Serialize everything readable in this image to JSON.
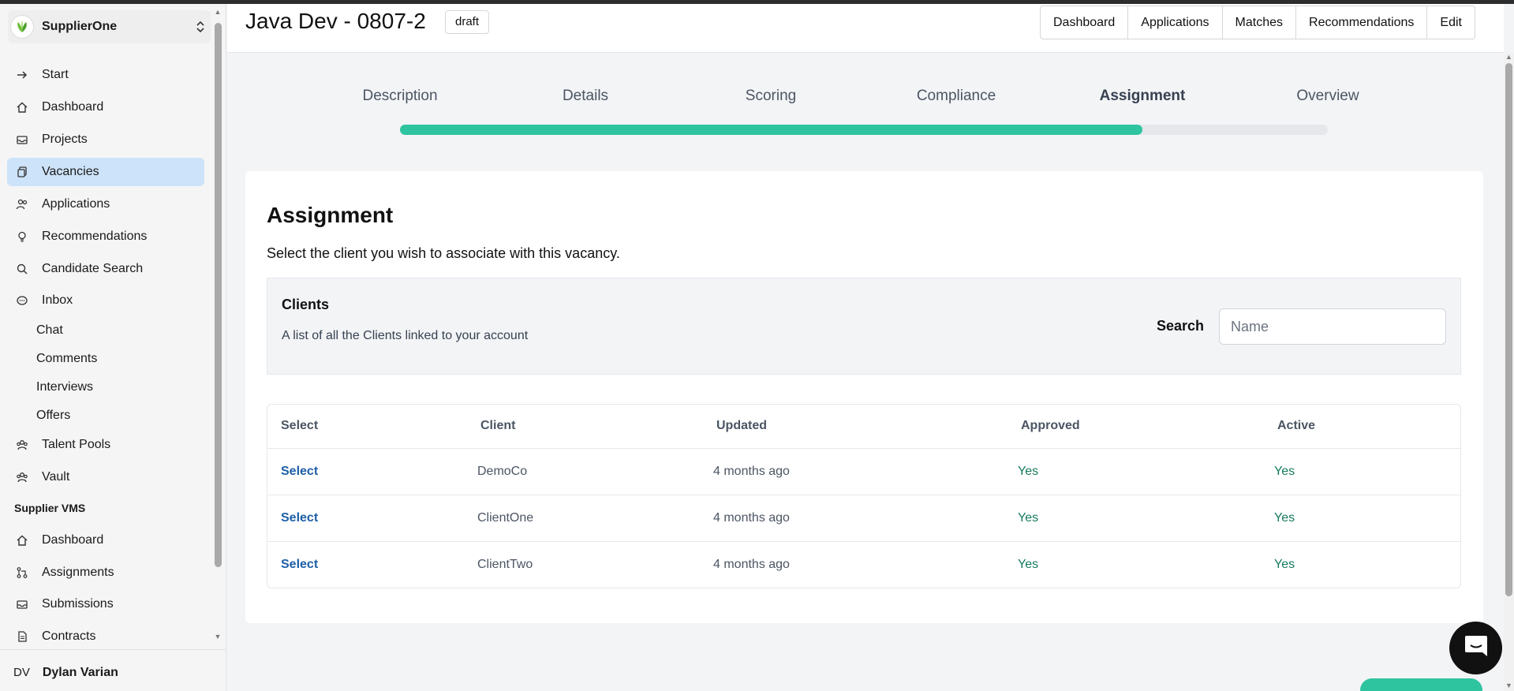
{
  "org": {
    "name": "SupplierOne"
  },
  "sidebar": {
    "items": [
      {
        "label": "Start",
        "icon": "arrow-right-icon"
      },
      {
        "label": "Dashboard",
        "icon": "home-icon"
      },
      {
        "label": "Projects",
        "icon": "inbox-stack-icon"
      },
      {
        "label": "Vacancies",
        "icon": "documents-icon",
        "active": true
      },
      {
        "label": "Applications",
        "icon": "users-icon"
      },
      {
        "label": "Recommendations",
        "icon": "lightbulb-icon"
      },
      {
        "label": "Candidate Search",
        "icon": "search-icon"
      },
      {
        "label": "Inbox",
        "icon": "chat-bubble-icon"
      }
    ],
    "inbox_sub": [
      "Chat",
      "Comments",
      "Interviews",
      "Offers"
    ],
    "items2": [
      {
        "label": "Talent Pools",
        "icon": "pools-icon"
      },
      {
        "label": "Vault",
        "icon": "vault-icon"
      }
    ],
    "section": "Supplier VMS",
    "vms_items": [
      {
        "label": "Dashboard",
        "icon": "home-icon"
      },
      {
        "label": "Assignments",
        "icon": "branch-icon"
      },
      {
        "label": "Submissions",
        "icon": "inbox-icon"
      },
      {
        "label": "Contracts",
        "icon": "document-icon"
      }
    ]
  },
  "user": {
    "initials": "DV",
    "name": "Dylan Varian"
  },
  "header": {
    "title": "Java Dev - 0807-2",
    "status": "draft",
    "buttons": [
      "Dashboard",
      "Applications",
      "Matches",
      "Recommendations",
      "Edit"
    ]
  },
  "steps": [
    "Description",
    "Details",
    "Scoring",
    "Compliance",
    "Assignment",
    "Overview"
  ],
  "current_step": "Assignment",
  "progress": 0.8,
  "assignment": {
    "title": "Assignment",
    "description": "Select the client you wish to associate with this vacancy.",
    "clients_title": "Clients",
    "clients_subtitle": "A list of all the Clients linked to your account",
    "search_label": "Search",
    "search_placeholder": "Name",
    "columns": [
      "Select",
      "Client",
      "Updated",
      "Approved",
      "Active"
    ],
    "rows": [
      {
        "select": "Select",
        "client": "DemoCo",
        "updated": "4 months ago",
        "approved": "Yes",
        "active": "Yes"
      },
      {
        "select": "Select",
        "client": "ClientOne",
        "updated": "4 months ago",
        "approved": "Yes",
        "active": "Yes"
      },
      {
        "select": "Select",
        "client": "ClientTwo",
        "updated": "4 months ago",
        "approved": "Yes",
        "active": "Yes"
      }
    ]
  },
  "colors": {
    "accent": "#2ec4a0",
    "active_nav": "#cde3f9",
    "link": "#1d5fa8",
    "yes": "#157a5e"
  }
}
